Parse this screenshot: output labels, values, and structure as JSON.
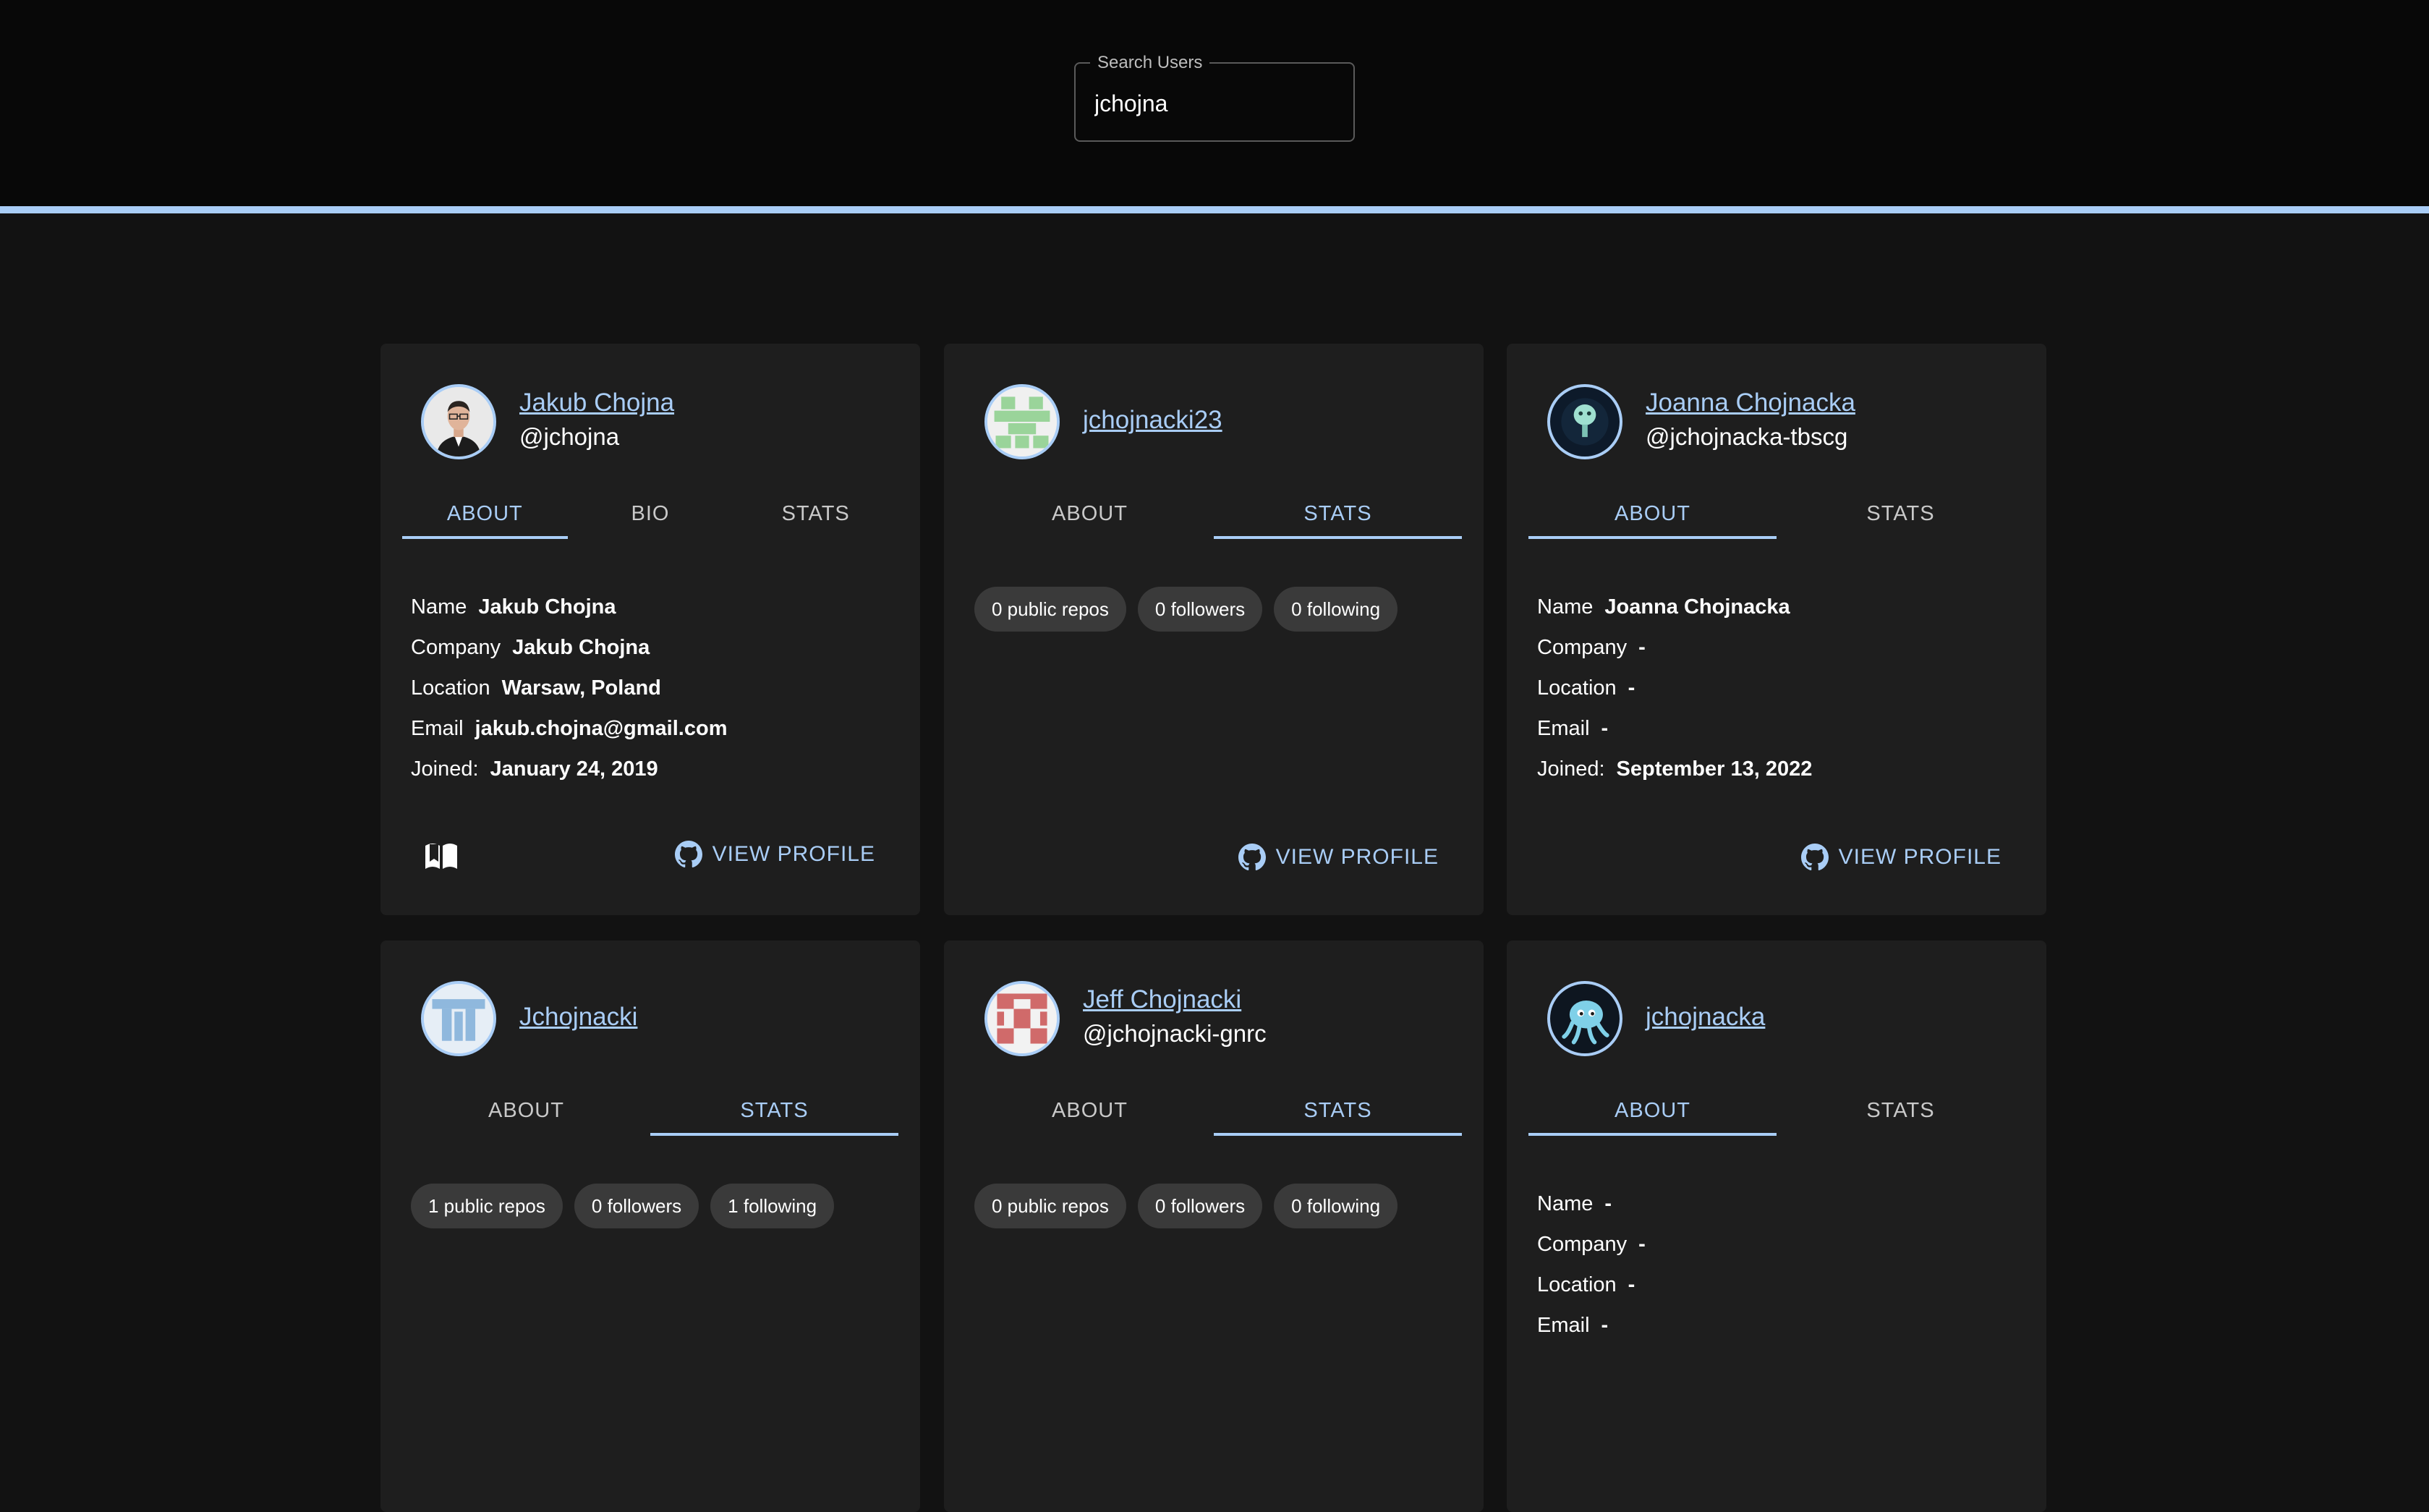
{
  "search": {
    "label": "Search Users",
    "value": "jchojna"
  },
  "cards": [
    {
      "name": "Jakub Chojna",
      "handle": "@jchojna",
      "tabs": [
        "ABOUT",
        "BIO",
        "STATS"
      ],
      "about": [
        {
          "label": "Name",
          "value": "Jakub Chojna"
        },
        {
          "label": "Company",
          "value": "Jakub Chojna"
        },
        {
          "label": "Location",
          "value": "Warsaw, Poland"
        },
        {
          "label": "Email",
          "value": "jakub.chojna@gmail.com"
        },
        {
          "label": "Joined:",
          "value": "January 24, 2019"
        }
      ],
      "view_profile": "VIEW PROFILE"
    },
    {
      "name": "jchojnacki23",
      "tabs": [
        "ABOUT",
        "STATS"
      ],
      "stats": [
        "0 public repos",
        "0 followers",
        "0 following"
      ],
      "view_profile": "VIEW PROFILE"
    },
    {
      "name": "Joanna Chojnacka",
      "handle": "@jchojnacka-tbscg",
      "tabs": [
        "ABOUT",
        "STATS"
      ],
      "about": [
        {
          "label": "Name",
          "value": "Joanna Chojnacka"
        },
        {
          "label": "Company",
          "value": "-"
        },
        {
          "label": "Location",
          "value": "-"
        },
        {
          "label": "Email",
          "value": "-"
        },
        {
          "label": "Joined:",
          "value": "September 13, 2022"
        }
      ],
      "view_profile": "VIEW PROFILE"
    },
    {
      "name": "Jchojnacki",
      "tabs": [
        "ABOUT",
        "STATS"
      ],
      "stats": [
        "1 public repos",
        "0 followers",
        "1 following"
      ]
    },
    {
      "name": "Jeff Chojnacki",
      "handle": "@jchojnacki-gnrc",
      "tabs": [
        "ABOUT",
        "STATS"
      ],
      "stats": [
        "0 public repos",
        "0 followers",
        "0 following"
      ]
    },
    {
      "name": "jchojnacka",
      "tabs": [
        "ABOUT",
        "STATS"
      ],
      "about": [
        {
          "label": "Name",
          "value": "-"
        },
        {
          "label": "Company",
          "value": "-"
        },
        {
          "label": "Location",
          "value": "-"
        },
        {
          "label": "Email",
          "value": "-"
        }
      ]
    }
  ],
  "icons": {
    "book": "open-book-icon",
    "github": "github-icon"
  },
  "colors": {
    "accent": "#a9cdf6",
    "card_bg": "#1e1e1e",
    "page_bg": "#121212",
    "chip_bg": "#3a3a3a"
  }
}
